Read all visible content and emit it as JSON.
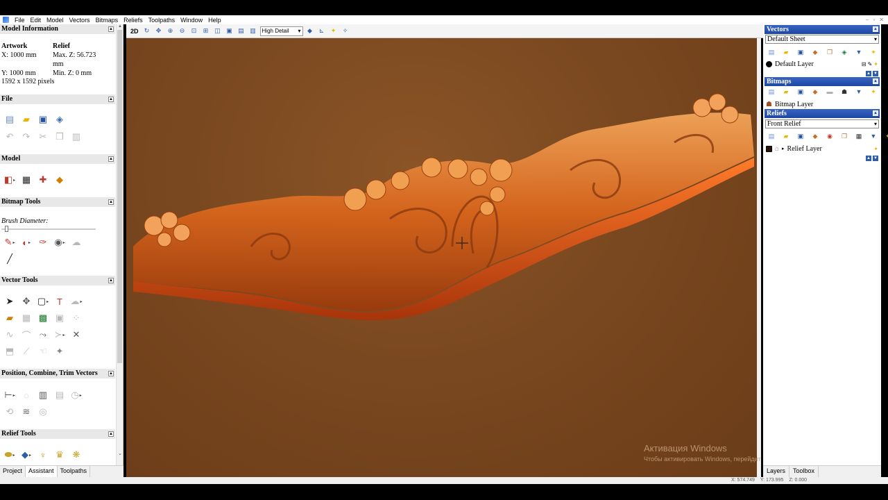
{
  "menu": [
    "File",
    "Edit",
    "Model",
    "Vectors",
    "Bitmaps",
    "Reliefs",
    "Toolpaths",
    "Window",
    "Help"
  ],
  "window_controls": [
    "–",
    "▫",
    "✕"
  ],
  "left": {
    "model_info": {
      "title": "Model Information",
      "artwork_label": "Artwork",
      "relief_label": "Relief",
      "x": "X: 1000 mm",
      "maxz": "Max. Z: 56.723",
      "maxz_unit": "mm",
      "y": "Y: 1000 mm",
      "minz": "Min. Z: 0 mm",
      "pixels": "1592 x 1592 pixels"
    },
    "file_title": "File",
    "model_title": "Model",
    "bitmap_tools_title": "Bitmap Tools",
    "brush_label": "Brush Diameter:",
    "brush_level": 0.04,
    "vector_tools_title": "Vector Tools",
    "position_title": "Position, Combine, Trim Vectors",
    "relief_tools_title": "Relief Tools",
    "tabs": [
      "Project",
      "Assistant",
      "Toolpaths"
    ]
  },
  "toolbar": {
    "view_2d": "2D",
    "detail": "High Detail"
  },
  "watermark": {
    "title": "Активация Windows",
    "subtitle": "Чтобы активировать Windows, перейдите в раздел \"Параметры\"."
  },
  "right": {
    "vectors_title": "Vectors",
    "vectors_sheet": "Default Sheet",
    "vector_layer": "Default Layer",
    "bitmaps_title": "Bitmaps",
    "bitmap_layer": "Bitmap Layer",
    "reliefs_title": "Reliefs",
    "relief_select": "Front Relief",
    "relief_layer": "Relief Layer",
    "tabs": [
      "Layers",
      "Toolbox"
    ]
  },
  "status": {
    "x": "X: 574.749",
    "y": "Y: 173.995",
    "z": "Z: 0.000"
  }
}
